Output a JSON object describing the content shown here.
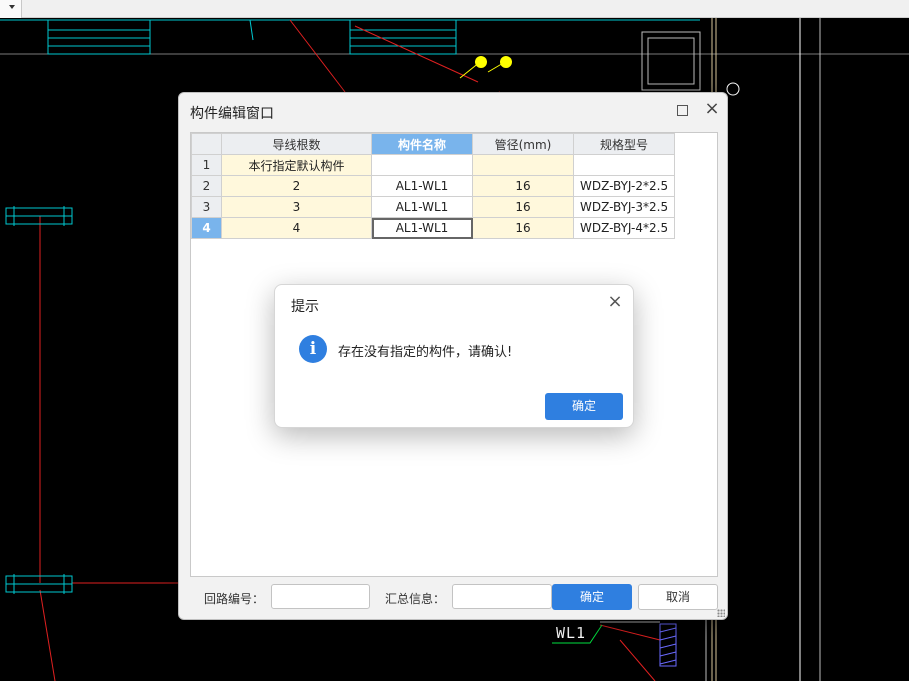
{
  "editor": {
    "title": "构件编辑窗口",
    "columns": [
      "",
      "导线根数",
      "构件名称",
      "管径(mm)",
      "规格型号"
    ],
    "rows": [
      {
        "num": "1",
        "wires": "本行指定默认构件",
        "name": "",
        "pipe": "",
        "spec": ""
      },
      {
        "num": "2",
        "wires": "2",
        "name": "AL1-WL1",
        "pipe": "16",
        "spec": "WDZ-BYJ-2*2.5"
      },
      {
        "num": "3",
        "wires": "3",
        "name": "AL1-WL1",
        "pipe": "16",
        "spec": "WDZ-BYJ-3*2.5"
      },
      {
        "num": "4",
        "wires": "4",
        "name": "AL1-WL1",
        "pipe": "16",
        "spec": "WDZ-BYJ-4*2.5"
      }
    ],
    "footer": {
      "circuit_label": "回路编号：",
      "circuit_value": "",
      "summary_label": "汇总信息：",
      "summary_value": "",
      "ok_label": "确定",
      "cancel_label": "取消"
    }
  },
  "dialog": {
    "title": "提示",
    "message": "存在没有指定的构件，请确认!",
    "ok_label": "确定"
  },
  "cad": {
    "label": "WL1"
  },
  "colors": {
    "accent": "#2f7fe0",
    "header_selected": "#79b4ec",
    "cell_highlight": "#fff8dc",
    "cad_cyan": "#00c8d0",
    "cad_red": "#e02020",
    "cad_yellow": "#ffff00",
    "cad_green": "#00e040"
  }
}
